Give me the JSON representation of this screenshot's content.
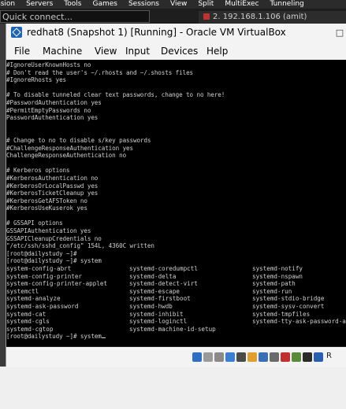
{
  "background_app": {
    "menu": [
      "ssion",
      "Servers",
      "Tools",
      "Games",
      "Sessions",
      "View",
      "Split",
      "MultiExec",
      "Tunneling"
    ],
    "quick_connect_placeholder": "Quick connect...",
    "session_tab": "2. 192.168.1.106 (amit)"
  },
  "window": {
    "title": "redhat8 (Snapshot 1) [Running] - Oracle VM VirtualBox",
    "maximize_glyph": "□"
  },
  "menubar": {
    "items": [
      "File",
      "Machine",
      "View",
      "Input",
      "Devices",
      "Help"
    ]
  },
  "terminal": {
    "lines": [
      "#IgnoreUserKnownHosts no",
      "# Don't read the user's ~/.rhosts and ~/.shosts files",
      "#IgnoreRhosts yes",
      "",
      "# To disable tunneled clear text passwords, change to no here!",
      "#PasswordAuthentication yes",
      "#PermitEmptyPasswords no",
      "PasswordAuthentication yes",
      "",
      "",
      "# Change to no to disable s/key passwords",
      "#ChallengeResponseAuthentication yes",
      "ChallengeResponseAuthentication no",
      "",
      "# Kerberos options",
      "#KerberosAuthentication no",
      "#KerberosOrLocalPasswd yes",
      "#KerberosTicketCleanup yes",
      "#KerberosGetAFSToken no",
      "#KerberosUseKuserok yes",
      "",
      "# GSSAPI options",
      "GSSAPIAuthentication yes",
      "GSSAPICleanupCredentials no",
      "\"/etc/ssh/sshd_config\" 154L, 4360C written",
      "[root@dailystudy ~]#",
      "[root@dailystudy ~]# system"
    ],
    "completions": [
      [
        "system-config-abrt",
        "systemd-coredumpctl",
        "systemd-notify"
      ],
      [
        "system-config-printer",
        "systemd-delta",
        "systemd-nspawn"
      ],
      [
        "system-config-printer-applet",
        "systemd-detect-virt",
        "systemd-path"
      ],
      [
        "systemctl",
        "systemd-escape",
        "systemd-run"
      ],
      [
        "systemd-analyze",
        "systemd-firstboot",
        "systemd-stdio-bridge"
      ],
      [
        "systemd-ask-password",
        "systemd-hwdb",
        "systemd-sysv-convert"
      ],
      [
        "systemd-cat",
        "systemd-inhibit",
        "systemd-tmpfiles"
      ],
      [
        "systemd-cgls",
        "systemd-loginctl",
        "systemd-tty-ask-password-agent"
      ],
      [
        "systemd-cgtop",
        "systemd-machine-id-setup",
        ""
      ]
    ],
    "prompt_line": "[root@dailystudy ~]# system"
  },
  "statusbar": {
    "icons": [
      {
        "name": "hard-disk-icon",
        "color": "#2f6fc2"
      },
      {
        "name": "optical-drive-icon",
        "color": "#9a9a9a"
      },
      {
        "name": "audio-icon",
        "color": "#8a8a8a"
      },
      {
        "name": "network-icon",
        "color": "#3b7fd0"
      },
      {
        "name": "usb-icon",
        "color": "#4a4a4a"
      },
      {
        "name": "shared-folders-icon",
        "color": "#e0a030"
      },
      {
        "name": "display-icon",
        "color": "#3a6fb5"
      },
      {
        "name": "video-capture-icon",
        "color": "#6a6a6a"
      },
      {
        "name": "recording-icon",
        "color": "#c03030"
      },
      {
        "name": "cpu-icon",
        "color": "#5a8a3a"
      },
      {
        "name": "mouse-integration-icon",
        "color": "#2a2a2a"
      },
      {
        "name": "host-key-arrow-icon",
        "color": "#2a60b0"
      }
    ],
    "host_key": "R"
  }
}
